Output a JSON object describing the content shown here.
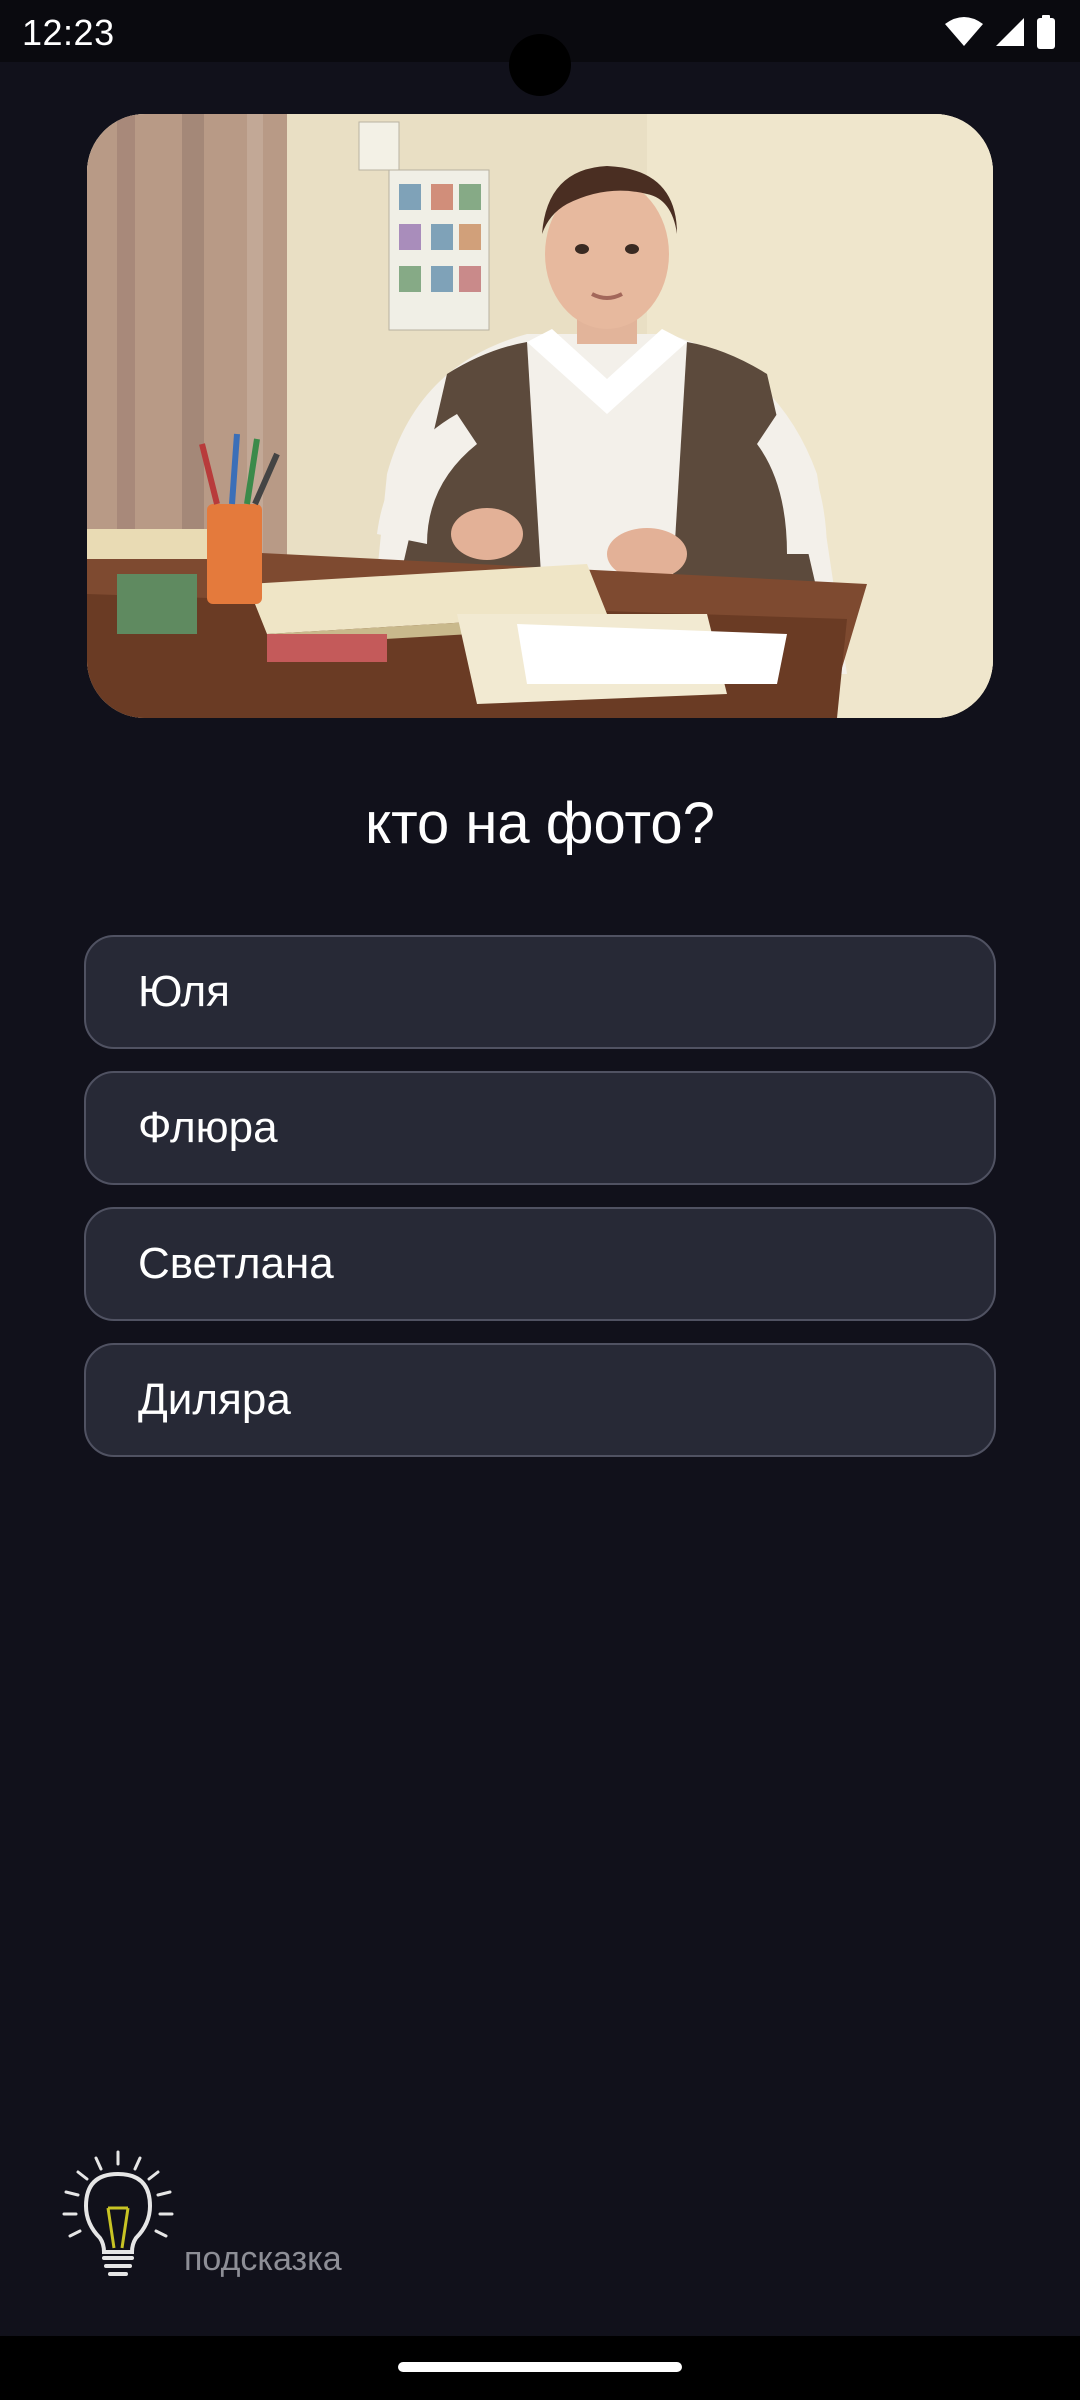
{
  "status_bar": {
    "time": "12:23",
    "icons": [
      "wifi-icon",
      "signal-icon",
      "battery-icon"
    ]
  },
  "photo": {
    "description_icon": "quiz-photo"
  },
  "question": "кто на фото?",
  "options": [
    {
      "label": "Юля"
    },
    {
      "label": "Флюра"
    },
    {
      "label": "Светлана"
    },
    {
      "label": "Диляра"
    }
  ],
  "hint": {
    "label": "подсказка",
    "icon": "lightbulb-icon"
  },
  "colors": {
    "background": "#11111b",
    "option_bg": "#272936",
    "option_border": "#505262",
    "hint_text": "#8d8e96"
  }
}
